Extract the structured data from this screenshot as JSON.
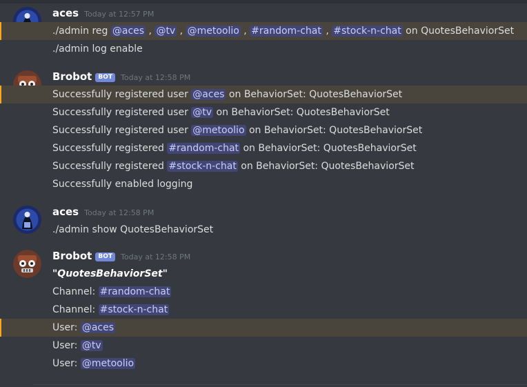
{
  "colors": {
    "background": "#36393f",
    "highlight": "#49443c",
    "accent_bar": "#faa61a",
    "mention_bg": "#414675",
    "mention_text": "#c9cdfb",
    "bot_tag": "#7289da"
  },
  "messages": [
    {
      "author": "aces",
      "avatar_icon": "aces-avatar-icon",
      "timestamp": "Today at 12:57 PM",
      "lines": [
        {
          "highlight": true,
          "parts": [
            {
              "t": "text",
              "v": "./admin reg "
            },
            {
              "t": "mention",
              "v": "@aces"
            },
            {
              "t": "text",
              "v": " , "
            },
            {
              "t": "mention",
              "v": "@tv"
            },
            {
              "t": "text",
              "v": " , "
            },
            {
              "t": "mention",
              "v": "@metoolio"
            },
            {
              "t": "text",
              "v": " , "
            },
            {
              "t": "mention",
              "v": "#random-chat"
            },
            {
              "t": "text",
              "v": " , "
            },
            {
              "t": "mention",
              "v": "#stock-n-chat"
            },
            {
              "t": "text",
              "v": "  on QuotesBehaviorSet"
            }
          ]
        },
        {
          "highlight": false,
          "parts": [
            {
              "t": "text",
              "v": "./admin log enable"
            }
          ]
        }
      ]
    },
    {
      "author": "Brobot",
      "bot_tag": "BOT",
      "avatar_icon": "brobot-avatar-icon",
      "timestamp": "Today at 12:58 PM",
      "lines": [
        {
          "highlight": true,
          "parts": [
            {
              "t": "text",
              "v": "Successfully registered user "
            },
            {
              "t": "mention",
              "v": "@aces"
            },
            {
              "t": "text",
              "v": " on BehaviorSet: QuotesBehaviorSet"
            }
          ]
        },
        {
          "highlight": false,
          "parts": [
            {
              "t": "text",
              "v": "Successfully registered user "
            },
            {
              "t": "mention",
              "v": "@tv"
            },
            {
              "t": "text",
              "v": " on BehaviorSet: QuotesBehaviorSet"
            }
          ]
        },
        {
          "highlight": false,
          "parts": [
            {
              "t": "text",
              "v": "Successfully registered user "
            },
            {
              "t": "mention",
              "v": "@metoolio"
            },
            {
              "t": "text",
              "v": " on BehaviorSet: QuotesBehaviorSet"
            }
          ]
        },
        {
          "highlight": false,
          "parts": [
            {
              "t": "text",
              "v": "Successfully registered "
            },
            {
              "t": "mention",
              "v": "#random-chat"
            },
            {
              "t": "text",
              "v": " on BehaviorSet: QuotesBehaviorSet"
            }
          ]
        },
        {
          "highlight": false,
          "parts": [
            {
              "t": "text",
              "v": "Successfully registered "
            },
            {
              "t": "mention",
              "v": "#stock-n-chat"
            },
            {
              "t": "text",
              "v": " on BehaviorSet: QuotesBehaviorSet"
            }
          ]
        },
        {
          "highlight": false,
          "parts": [
            {
              "t": "text",
              "v": "Successfully enabled logging"
            }
          ]
        }
      ]
    },
    {
      "author": "aces",
      "avatar_icon": "aces-avatar-icon",
      "timestamp": "Today at 12:58 PM",
      "lines": [
        {
          "highlight": false,
          "parts": [
            {
              "t": "text",
              "v": "./admin show QuotesBehaviorSet"
            }
          ]
        }
      ]
    },
    {
      "author": "Brobot",
      "bot_tag": "BOT",
      "avatar_icon": "brobot-avatar-icon",
      "timestamp": "Today at 12:58 PM",
      "lines": [
        {
          "highlight": false,
          "parts": [
            {
              "t": "bolditalic",
              "v": "\"QuotesBehaviorSet\""
            }
          ]
        },
        {
          "highlight": false,
          "parts": [
            {
              "t": "text",
              "v": "Channel: "
            },
            {
              "t": "mention",
              "v": "#random-chat"
            }
          ]
        },
        {
          "highlight": false,
          "parts": [
            {
              "t": "text",
              "v": "Channel: "
            },
            {
              "t": "mention",
              "v": "#stock-n-chat"
            }
          ]
        },
        {
          "highlight": true,
          "parts": [
            {
              "t": "text",
              "v": "User: "
            },
            {
              "t": "mention",
              "v": "@aces"
            }
          ]
        },
        {
          "highlight": false,
          "parts": [
            {
              "t": "text",
              "v": "User: "
            },
            {
              "t": "mention",
              "v": "@tv"
            }
          ]
        },
        {
          "highlight": false,
          "parts": [
            {
              "t": "text",
              "v": "User: "
            },
            {
              "t": "mention",
              "v": "@metoolio"
            }
          ]
        }
      ]
    }
  ]
}
